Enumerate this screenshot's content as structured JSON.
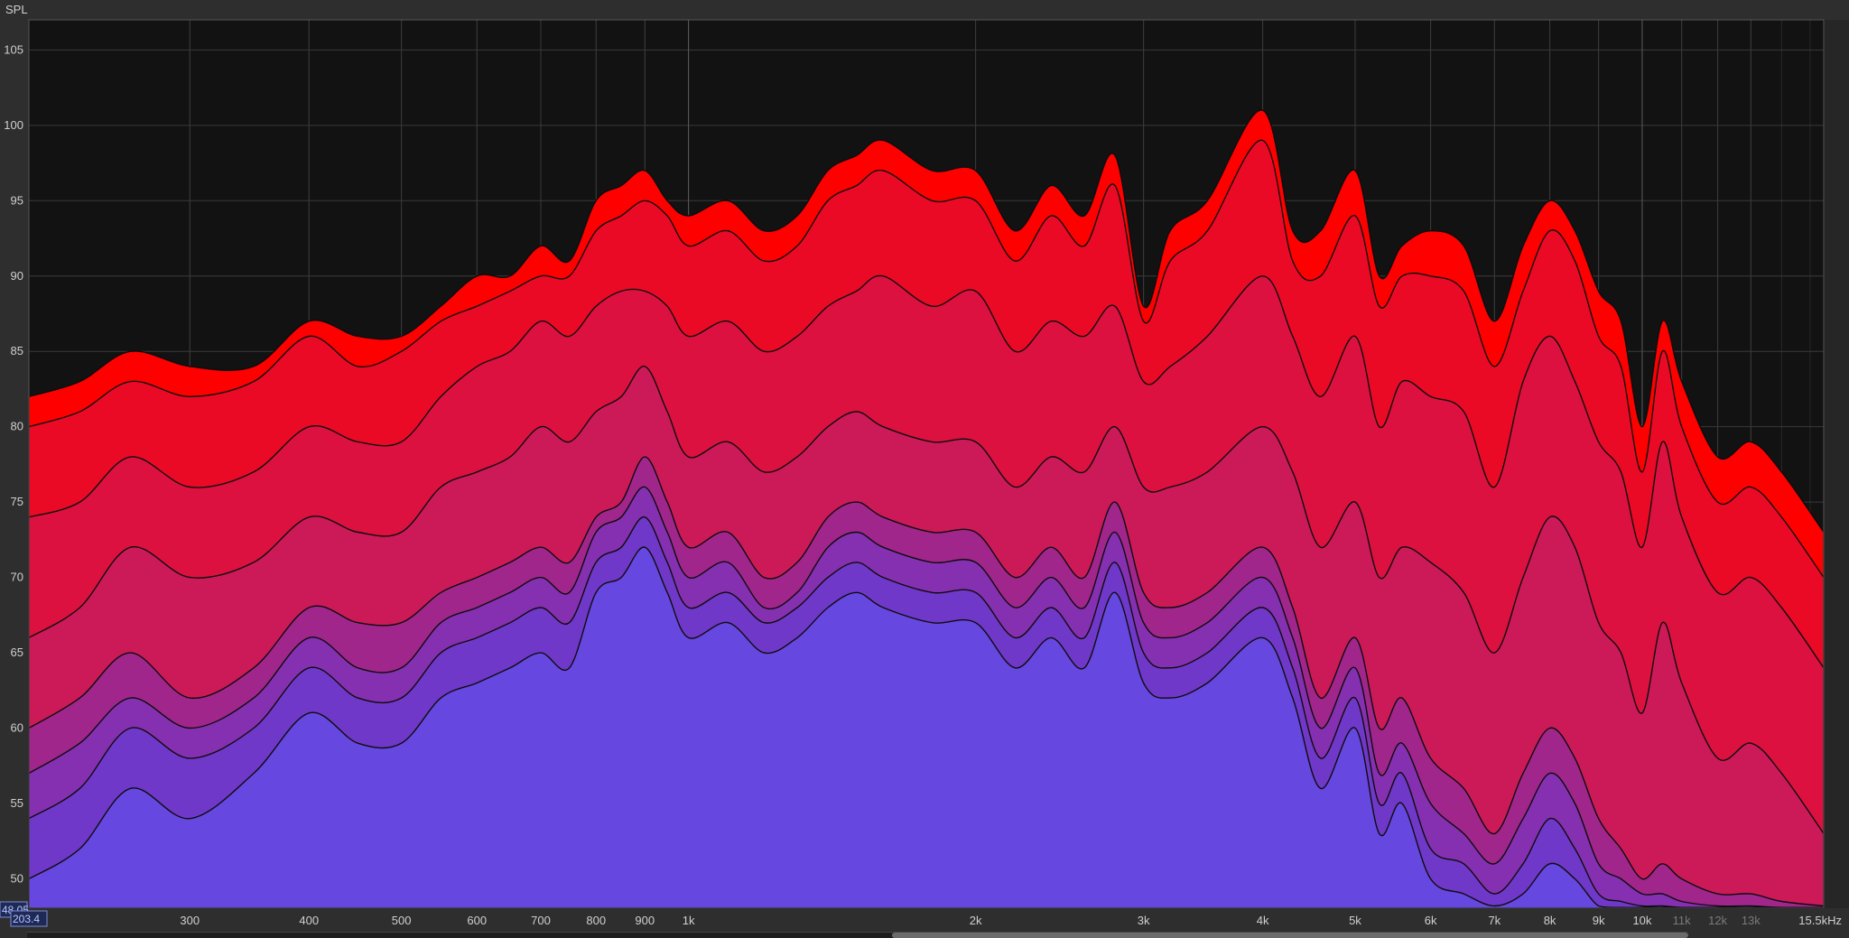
{
  "app": {
    "y_title": "SPL"
  },
  "readout": {
    "spl_value": "48.05",
    "freq_value": "203.4"
  },
  "colors": {
    "background": "#2e2e2e",
    "plot_bg": "#121212",
    "grid": "#3a3a3a",
    "curve_stroke": "#0d0d0d",
    "bottom_fill": "#6647e0",
    "top_fill": "#ff0000"
  },
  "chart_data": {
    "type": "area",
    "title": "",
    "xlabel": "",
    "ylabel": "SPL",
    "x_scale": "log",
    "xlim": [
      203.4,
      15500
    ],
    "ylim": [
      48.05,
      107
    ],
    "grid": true,
    "y_ticks": [
      50,
      55,
      60,
      65,
      70,
      75,
      80,
      85,
      90,
      95,
      100,
      105
    ],
    "x_ticks": [
      {
        "value": 300,
        "label": "300",
        "dim": false
      },
      {
        "value": 400,
        "label": "400",
        "dim": false
      },
      {
        "value": 500,
        "label": "500",
        "dim": false
      },
      {
        "value": 600,
        "label": "600",
        "dim": false
      },
      {
        "value": 700,
        "label": "700",
        "dim": false
      },
      {
        "value": 800,
        "label": "800",
        "dim": false
      },
      {
        "value": 900,
        "label": "900",
        "dim": false
      },
      {
        "value": 1000,
        "label": "1k",
        "dim": false
      },
      {
        "value": 2000,
        "label": "2k",
        "dim": false
      },
      {
        "value": 3000,
        "label": "3k",
        "dim": false
      },
      {
        "value": 4000,
        "label": "4k",
        "dim": false
      },
      {
        "value": 5000,
        "label": "5k",
        "dim": false
      },
      {
        "value": 6000,
        "label": "6k",
        "dim": false
      },
      {
        "value": 7000,
        "label": "7k",
        "dim": false
      },
      {
        "value": 8000,
        "label": "8k",
        "dim": false
      },
      {
        "value": 9000,
        "label": "9k",
        "dim": false
      },
      {
        "value": 10000,
        "label": "10k",
        "dim": false
      },
      {
        "value": 11000,
        "label": "11k",
        "dim": true
      },
      {
        "value": 12000,
        "label": "12k",
        "dim": true
      },
      {
        "value": 13000,
        "label": "13k",
        "dim": true
      },
      {
        "value": 15500,
        "label": "15.5kHz",
        "dim": false
      }
    ],
    "x": [
      203.4,
      230,
      260,
      300,
      350,
      400,
      450,
      500,
      550,
      600,
      650,
      700,
      750,
      800,
      850,
      900,
      950,
      1000,
      1100,
      1200,
      1300,
      1400,
      1500,
      1600,
      1800,
      2000,
      2200,
      2400,
      2600,
      2800,
      3000,
      3200,
      3500,
      4000,
      4300,
      4600,
      5000,
      5300,
      5600,
      6000,
      6500,
      7000,
      7500,
      8000,
      8500,
      9000,
      9500,
      10000,
      10500,
      11000,
      12000,
      13000,
      14000,
      15500
    ],
    "series": [
      {
        "fill": "#ff0000",
        "values": [
          82,
          83,
          85,
          84,
          84,
          87,
          86,
          86,
          88,
          90,
          90,
          92,
          91,
          95,
          96,
          97,
          95,
          94,
          95,
          93,
          94,
          97,
          98,
          99,
          97,
          97,
          93,
          96,
          94,
          98,
          88,
          93,
          95,
          101,
          93,
          93,
          97,
          90,
          92,
          93,
          92,
          87,
          92,
          95,
          93,
          89,
          87,
          80,
          87,
          83,
          78,
          79,
          77,
          73
        ]
      },
      {
        "fill": "#eb0a25",
        "values": [
          80,
          81,
          83,
          82,
          83,
          86,
          84,
          85,
          87,
          88,
          89,
          90,
          90,
          93,
          94,
          95,
          94,
          92,
          93,
          91,
          92,
          95,
          96,
          97,
          95,
          95,
          91,
          94,
          92,
          96,
          87,
          91,
          93,
          99,
          91,
          90,
          94,
          88,
          90,
          90,
          89,
          84,
          89,
          93,
          91,
          86,
          84,
          77,
          85,
          80,
          75,
          76,
          74,
          70
        ]
      },
      {
        "fill": "#dc1140",
        "values": [
          74,
          75,
          78,
          76,
          77,
          80,
          79,
          79,
          82,
          84,
          85,
          87,
          86,
          88,
          89,
          89,
          88,
          86,
          87,
          85,
          86,
          88,
          89,
          90,
          88,
          89,
          85,
          87,
          86,
          88,
          83,
          84,
          86,
          90,
          86,
          82,
          86,
          80,
          83,
          82,
          81,
          76,
          83,
          86,
          83,
          79,
          77,
          72,
          79,
          74,
          69,
          70,
          68,
          64
        ]
      },
      {
        "fill": "#cc1a58",
        "values": [
          66,
          68,
          72,
          70,
          71,
          74,
          73,
          73,
          76,
          77,
          78,
          80,
          79,
          81,
          82,
          84,
          81,
          78,
          79,
          77,
          78,
          80,
          81,
          80,
          79,
          79,
          76,
          78,
          77,
          80,
          76,
          76,
          77,
          80,
          77,
          72,
          75,
          70,
          72,
          71,
          69,
          65,
          70,
          74,
          72,
          67,
          65,
          61,
          67,
          63,
          58,
          59,
          57,
          53
        ]
      },
      {
        "fill": "#a0268c",
        "values": [
          60,
          62,
          65,
          62,
          64,
          68,
          67,
          67,
          69,
          70,
          71,
          72,
          71,
          74,
          75,
          78,
          75,
          72,
          73,
          70,
          71,
          74,
          75,
          74,
          73,
          73,
          70,
          72,
          70,
          75,
          69,
          68,
          69,
          72,
          68,
          62,
          66,
          60,
          62,
          58,
          56,
          53,
          57,
          60,
          58,
          54,
          52,
          50,
          51,
          50,
          49,
          49,
          48.5,
          48.2
        ]
      },
      {
        "fill": "#8530b0",
        "values": [
          57,
          59,
          62,
          60,
          62,
          66,
          64,
          64,
          67,
          68,
          69,
          70,
          69,
          73,
          74,
          76,
          73,
          70,
          71,
          68,
          69,
          72,
          73,
          72,
          71,
          71,
          68,
          70,
          68,
          73,
          67,
          66,
          67,
          70,
          66,
          60,
          64,
          57,
          59,
          55,
          53,
          51,
          54,
          57,
          55,
          51,
          50,
          49,
          49,
          48.5,
          48.2,
          48.2,
          48.1,
          48.1
        ]
      },
      {
        "fill": "#7038c8",
        "values": [
          54,
          56,
          60,
          58,
          60,
          64,
          62,
          62,
          65,
          66,
          67,
          68,
          67,
          71,
          72,
          74,
          71,
          68,
          69,
          67,
          68,
          70,
          71,
          70,
          69,
          69,
          66,
          68,
          66,
          71,
          65,
          64,
          65,
          68,
          64,
          58,
          62,
          55,
          57,
          52,
          51,
          49,
          51,
          54,
          52,
          49,
          48.5,
          48.2,
          48.2,
          48.1,
          48.1,
          48.1,
          48.1,
          48.1
        ]
      },
      {
        "fill": "#6647e0",
        "values": [
          50,
          52,
          56,
          54,
          57,
          61,
          59,
          59,
          62,
          63,
          64,
          65,
          64,
          69,
          70,
          72,
          69,
          66,
          67,
          65,
          66,
          68,
          69,
          68,
          67,
          67,
          64,
          66,
          64,
          69,
          63,
          62,
          63,
          66,
          62,
          56,
          60,
          53,
          55,
          50,
          49,
          48.2,
          49,
          51,
          50,
          48.2,
          48.1,
          48.1,
          48.1,
          48.1,
          48.1,
          48.1,
          48.1,
          48.1
        ]
      }
    ]
  }
}
